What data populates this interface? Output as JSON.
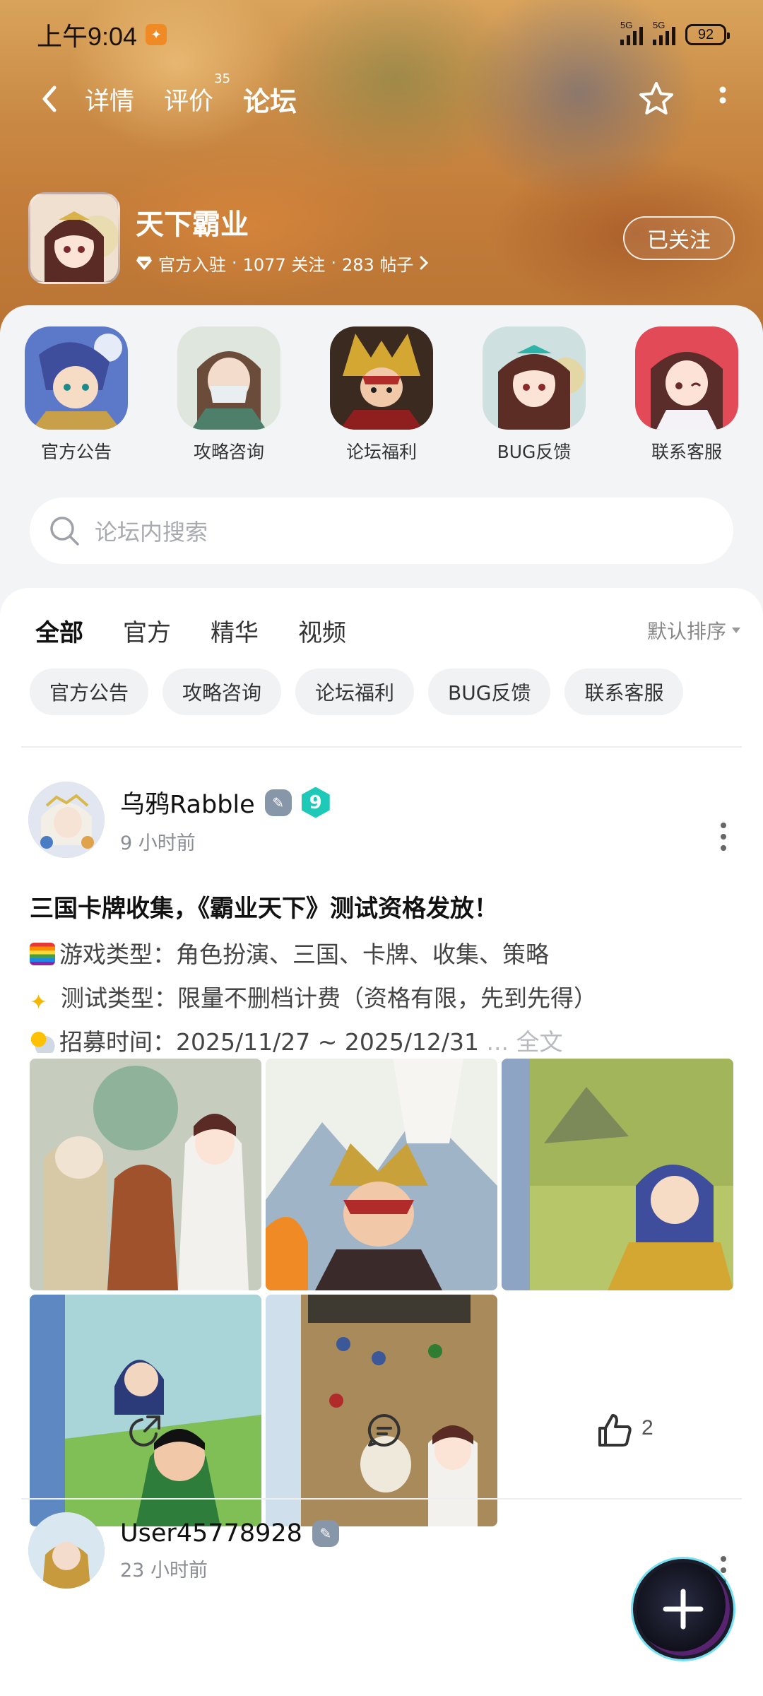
{
  "status_bar": {
    "time": "上午9:04",
    "battery": "92",
    "net1": "5G",
    "net2": "5G"
  },
  "nav": {
    "tabs": [
      {
        "label": "详情"
      },
      {
        "label": "评价",
        "badge": "35"
      },
      {
        "label": "论坛"
      }
    ],
    "active_tab": "论坛"
  },
  "game": {
    "title": "天下霸业",
    "official": "官方入驻",
    "follows": "1077 关注",
    "posts": "283 帖子",
    "sep": "·",
    "follow_button": "已关注"
  },
  "categories": [
    {
      "label": "官方公告",
      "color_a": "#3e4e9c",
      "color_b": "#8fb2e8"
    },
    {
      "label": "攻略咨询",
      "color_a": "#6f8a7a",
      "color_b": "#e9dcc8"
    },
    {
      "label": "论坛福利",
      "color_a": "#2b1a12",
      "color_b": "#c9392f"
    },
    {
      "label": "BUG反馈",
      "color_a": "#5b2d24",
      "color_b": "#eec9b5"
    },
    {
      "label": "联系客服",
      "color_a": "#5b2d2a",
      "color_b": "#f5c4c6"
    }
  ],
  "search": {
    "placeholder": "论坛内搜索"
  },
  "feed_tabs": {
    "items": [
      "全部",
      "官方",
      "精华",
      "视频"
    ],
    "sort": "默认排序"
  },
  "chips": [
    "官方公告",
    "攻略咨询",
    "论坛福利",
    "BUG反馈",
    "联系客服"
  ],
  "post": {
    "author": "乌鸦Rabble",
    "level": "9",
    "time": "9 小时前",
    "title": "三国卡牌收集，《霸业天下》测试资格发放！",
    "lines": [
      "游戏类型：角色扮演、三国、卡牌、收集、策略",
      "测试类型：限量不删档计费（资格有限，先到先得）",
      "招募时间：2025/11/27 ~ 2025/12/31"
    ],
    "more": " ... 全文",
    "likes": "2"
  },
  "post2": {
    "author": "User45778928",
    "time": "23 小时前"
  },
  "colors": {
    "accent": "#2fd0c0",
    "hero": "#c98a45"
  }
}
